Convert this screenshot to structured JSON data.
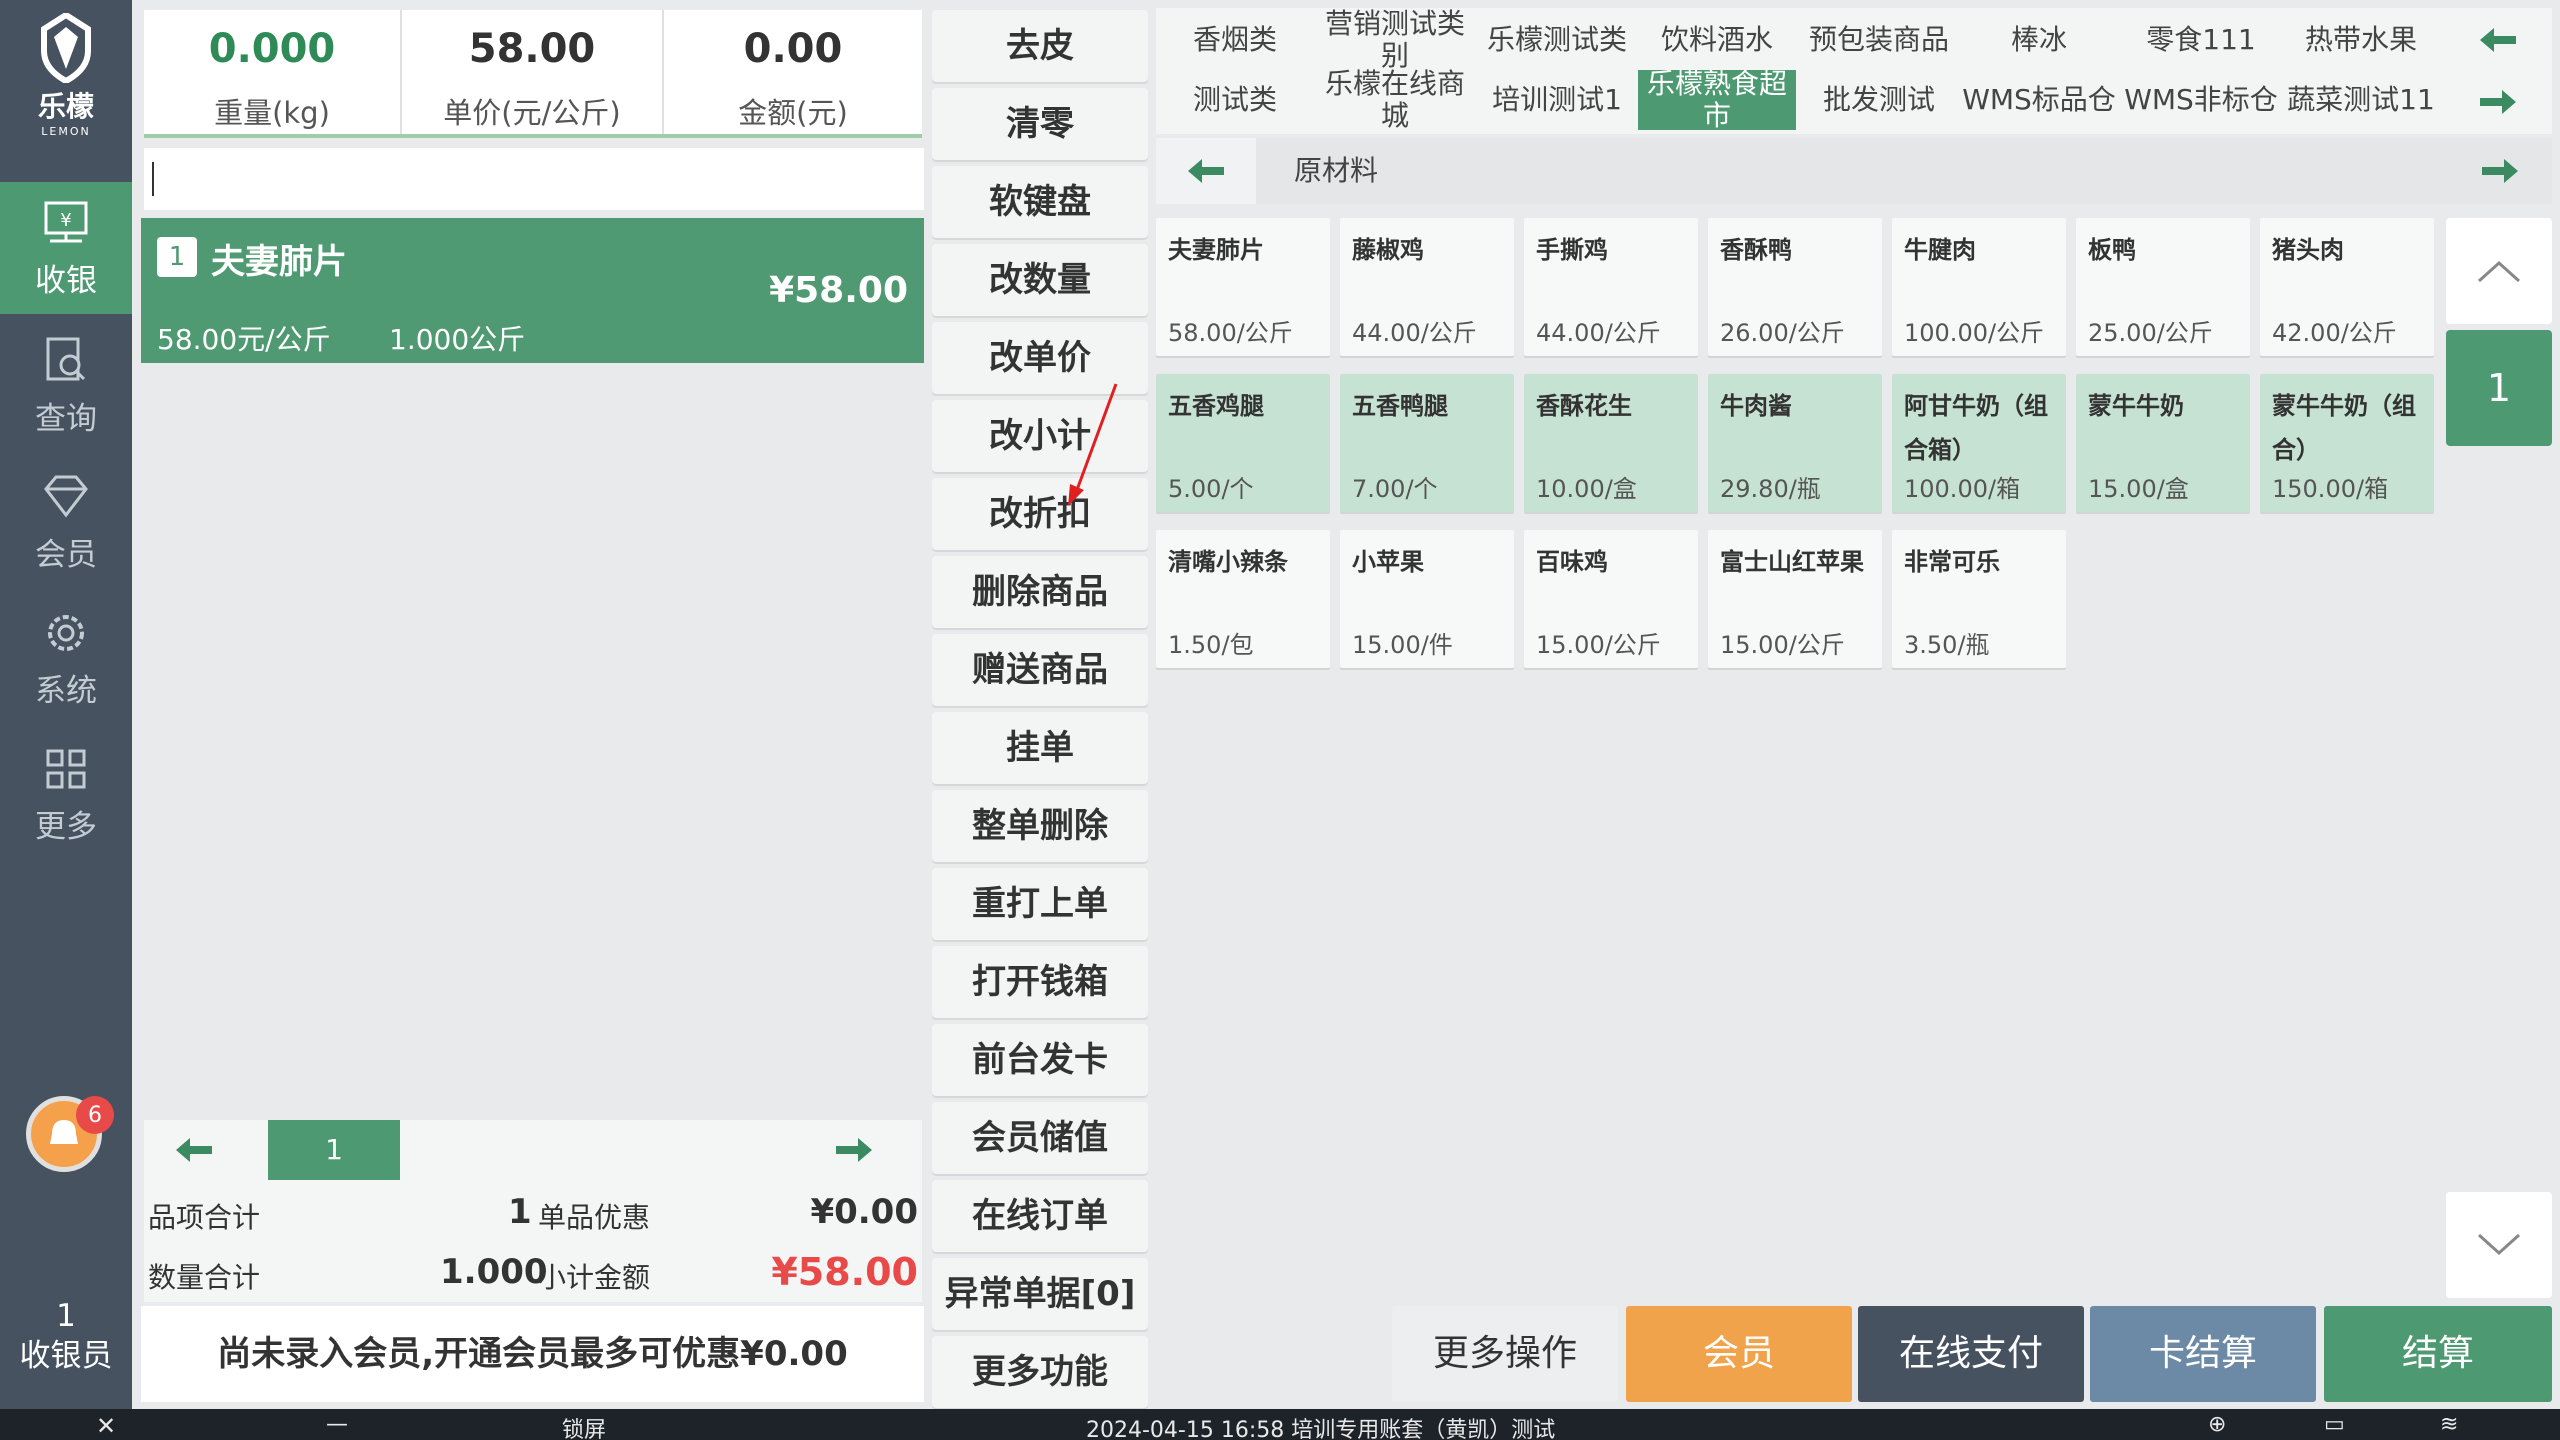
{
  "sidebar": {
    "logo_cn": "乐檬",
    "logo_en": "LEMON",
    "items": [
      {
        "label": "收银",
        "icon": "cashier-icon"
      },
      {
        "label": "查询",
        "icon": "query-icon"
      },
      {
        "label": "会员",
        "icon": "member-diamond-icon"
      },
      {
        "label": "系统",
        "icon": "gear-icon"
      },
      {
        "label": "更多",
        "icon": "grid-icon"
      }
    ],
    "notification_count": "6",
    "cashier_id": "1",
    "cashier_label": "收银员"
  },
  "scale": {
    "weight": "0.000",
    "weight_label": "重量(kg)",
    "unit_price": "58.00",
    "unit_price_label": "单价(元/公斤)",
    "amount": "0.00",
    "amount_label": "金额(元)"
  },
  "order": {
    "items": [
      {
        "index": "1",
        "name": "夫妻肺片",
        "price": "¥58.00",
        "unit_price": "58.00元/公斤",
        "quantity": "1.000公斤"
      }
    ],
    "page": "1"
  },
  "summary": {
    "item_total_label": "品项合计",
    "item_total": "1",
    "discount_label": "单品优惠",
    "discount": "¥0.00",
    "qty_total_label": "数量合计",
    "qty_total": "1.000",
    "subtotal_label": "小计金额",
    "subtotal": "¥58.00"
  },
  "member_prompt": "尚未录入会员,开通会员最多可优惠¥0.00",
  "functions": [
    "去皮",
    "清零",
    "软键盘",
    "改数量",
    "改单价",
    "改小计",
    "改折扣",
    "删除商品",
    "赠送商品",
    "挂单",
    "整单删除",
    "重打上单",
    "打开钱箱",
    "前台发卡",
    "会员储值",
    "在线订单",
    "异常单据[0]",
    "更多功能"
  ],
  "categories": {
    "row1": [
      "香烟类",
      "营销测试类别",
      "乐檬测试类",
      "饮料酒水",
      "预包装商品",
      "棒冰",
      "零食111",
      "热带水果"
    ],
    "row2": [
      "测试类",
      "乐檬在线商城",
      "培训测试1",
      "乐檬熟食超市",
      "批发测试",
      "WMS标品仓",
      "WMS非标仓",
      "蔬菜测试11"
    ],
    "active": "乐檬熟食超市",
    "sub": "原材料"
  },
  "products": [
    {
      "name": "夫妻肺片",
      "price": "58.00/公斤"
    },
    {
      "name": "藤椒鸡",
      "price": "44.00/公斤"
    },
    {
      "name": "手撕鸡",
      "price": "44.00/公斤"
    },
    {
      "name": "香酥鸭",
      "price": "26.00/公斤"
    },
    {
      "name": "牛腱肉",
      "price": "100.00/公斤"
    },
    {
      "name": "板鸭",
      "price": "25.00/公斤"
    },
    {
      "name": "猪头肉",
      "price": "42.00/公斤"
    },
    {
      "name": "五香鸡腿",
      "price": "5.00/个"
    },
    {
      "name": "五香鸭腿",
      "price": "7.00/个"
    },
    {
      "name": "香酥花生",
      "price": "10.00/盒"
    },
    {
      "name": "牛肉酱",
      "price": "29.80/瓶"
    },
    {
      "name": "阿甘牛奶（组合箱）",
      "price": "100.00/箱"
    },
    {
      "name": "蒙牛牛奶",
      "price": "15.00/盒"
    },
    {
      "name": "蒙牛牛奶（组合）",
      "price": "150.00/箱"
    },
    {
      "name": "清嘴小辣条",
      "price": "1.50/包"
    },
    {
      "name": "小苹果",
      "price": "15.00/件"
    },
    {
      "name": "百味鸡",
      "price": "15.00/公斤"
    },
    {
      "name": "富士山红苹果",
      "price": "15.00/公斤"
    },
    {
      "name": "非常可乐",
      "price": "3.50/瓶"
    }
  ],
  "product_page": "1",
  "actions": {
    "more_ops": "更多操作",
    "member": "会员",
    "online_pay": "在线支付",
    "card_settle": "卡结算",
    "settle": "结算"
  },
  "statusbar": {
    "lock": "锁屏",
    "info": "2024-04-15 16:58 培训专用账套（黄凯）测试"
  },
  "colors": {
    "primary_green": "#4d9a72",
    "tile_green": "#c6e2d3",
    "sidebar": "#46525f",
    "member_orange": "#f0a34b",
    "online_pay_dark": "#46525f",
    "card_settle_blue": "#6c8aa6",
    "subtotal_red": "#e84a4a"
  }
}
